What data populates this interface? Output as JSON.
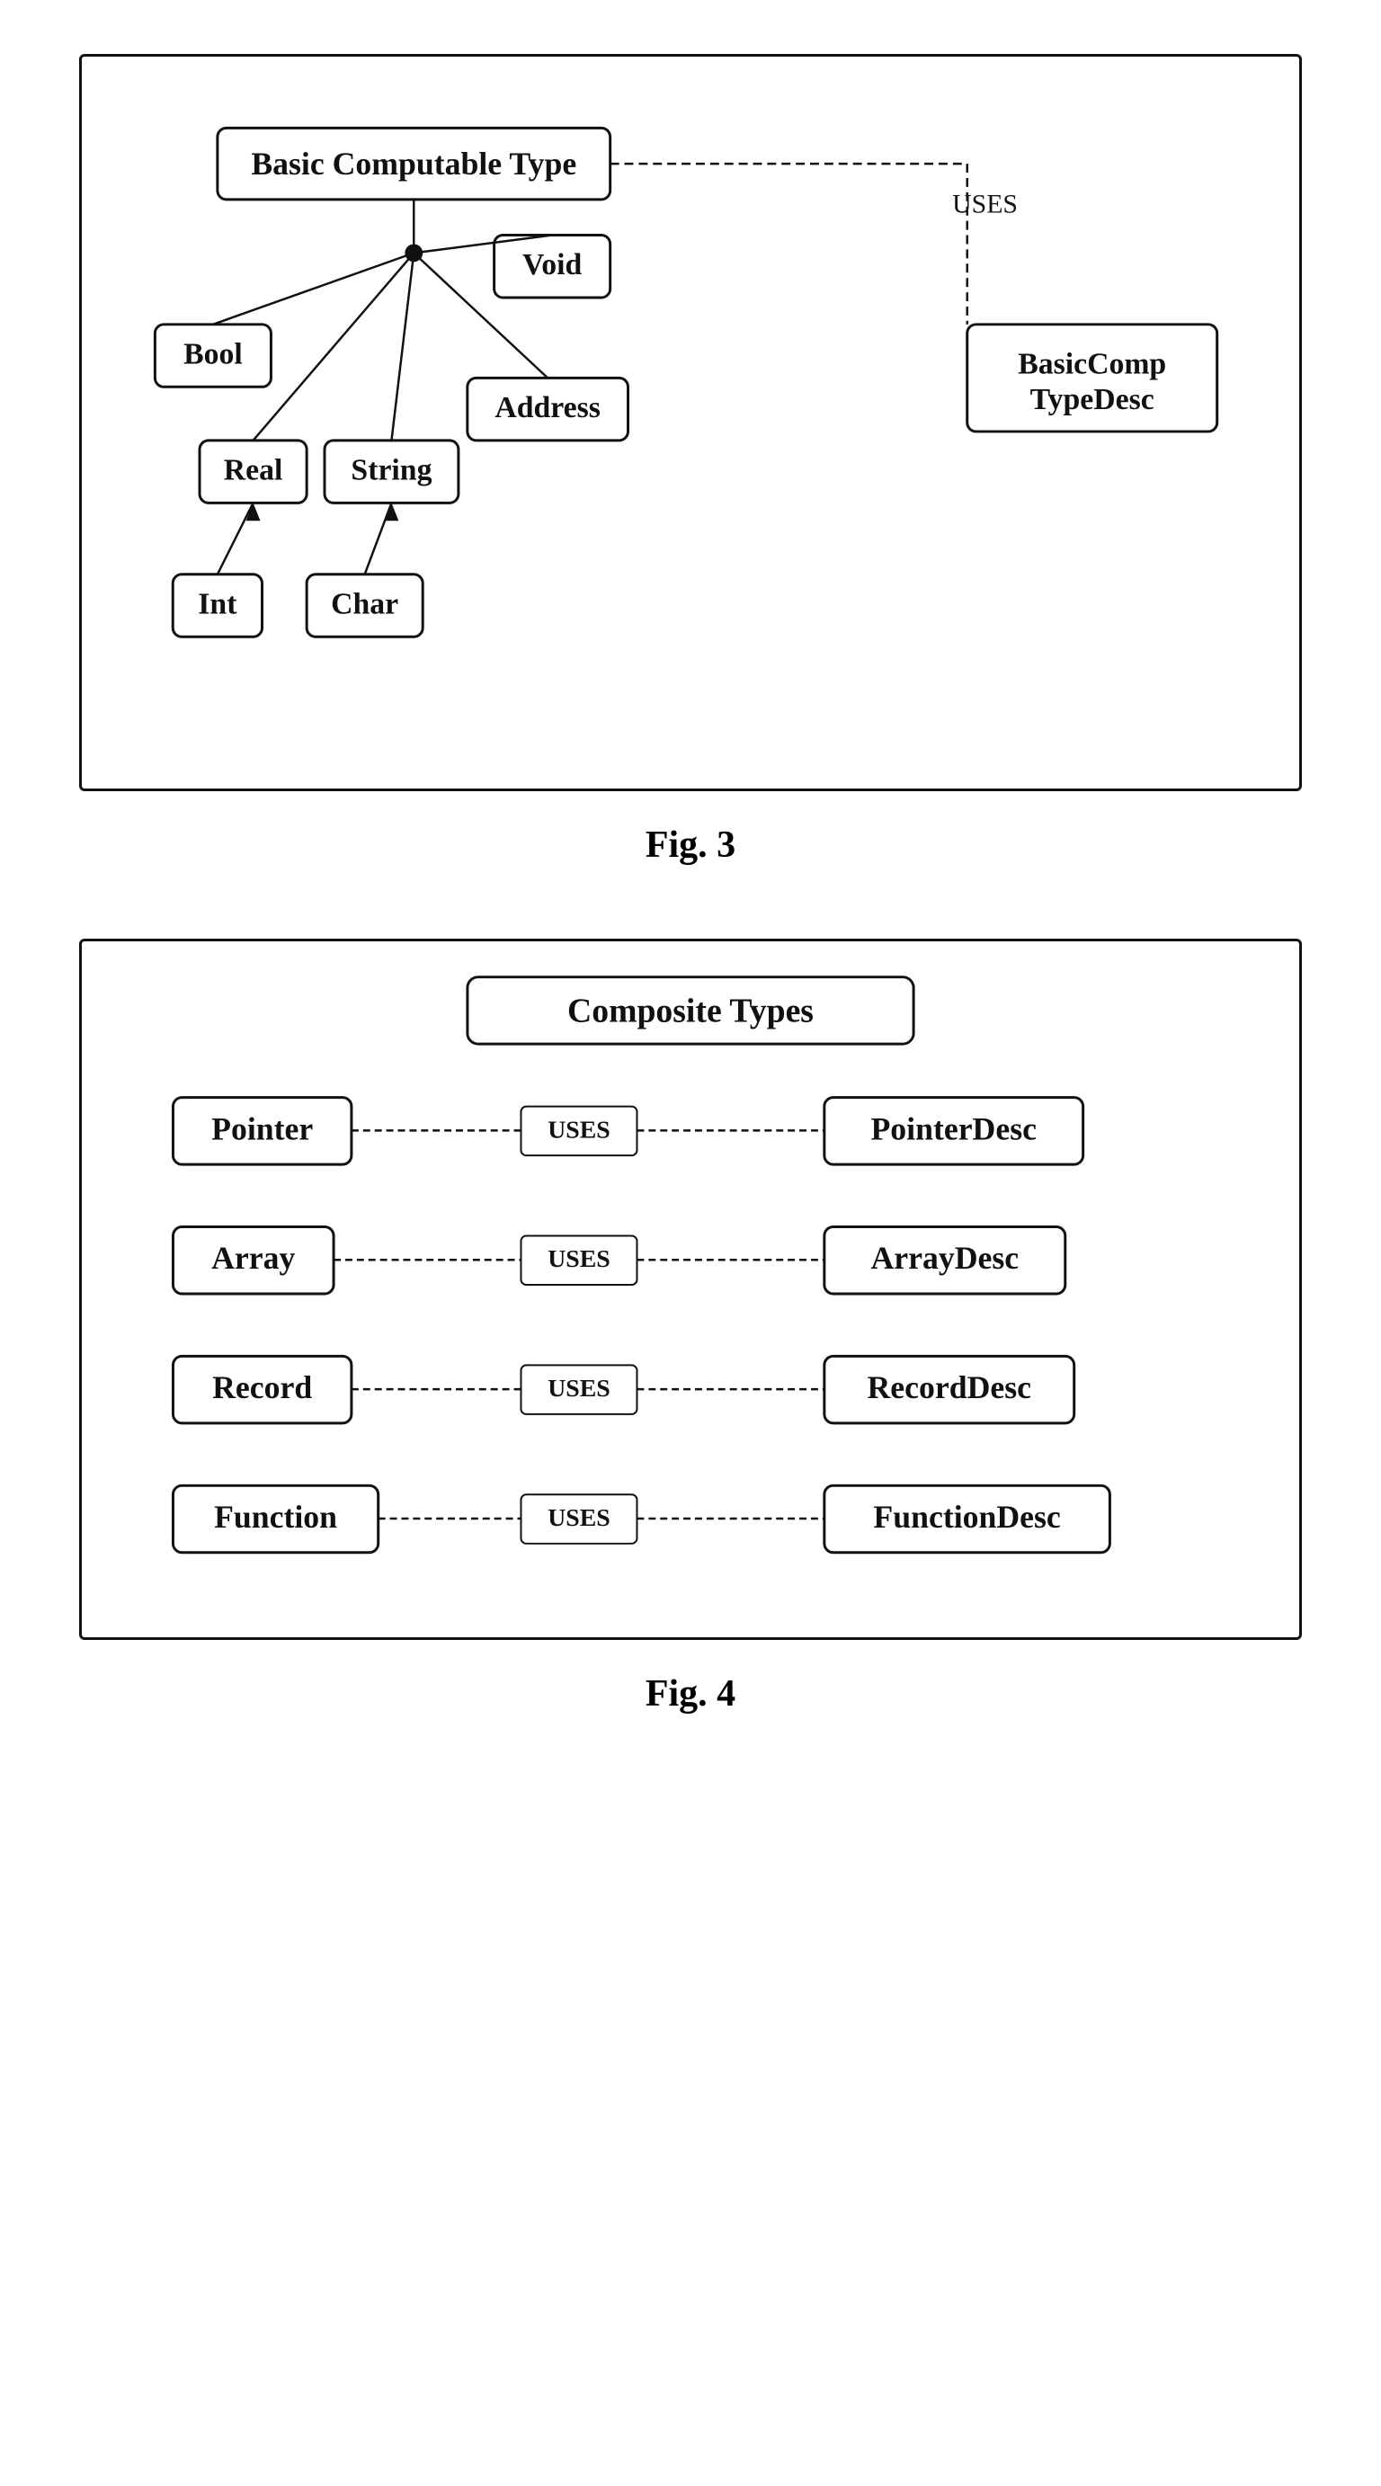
{
  "fig3": {
    "caption": "Fig. 3",
    "nodes": {
      "basicComputableType": "Basic Computable Type",
      "bool": "Bool",
      "void": "Void",
      "real": "Real",
      "string": "String",
      "address": "Address",
      "int": "Int",
      "char": "Char",
      "basicCompTypeDesc": "BasicComp\nTypeDesc",
      "uses": "USES"
    }
  },
  "fig4": {
    "caption": "Fig. 4",
    "nodes": {
      "compositeTypes": "Composite Types",
      "pointer": "Pointer",
      "pointerDesc": "PointerDesc",
      "array": "Array",
      "arrayDesc": "ArrayDesc",
      "record": "Record",
      "recordDesc": "RecordDesc",
      "function": "Function",
      "functionDesc": "FunctionDesc",
      "uses": "USES"
    }
  }
}
